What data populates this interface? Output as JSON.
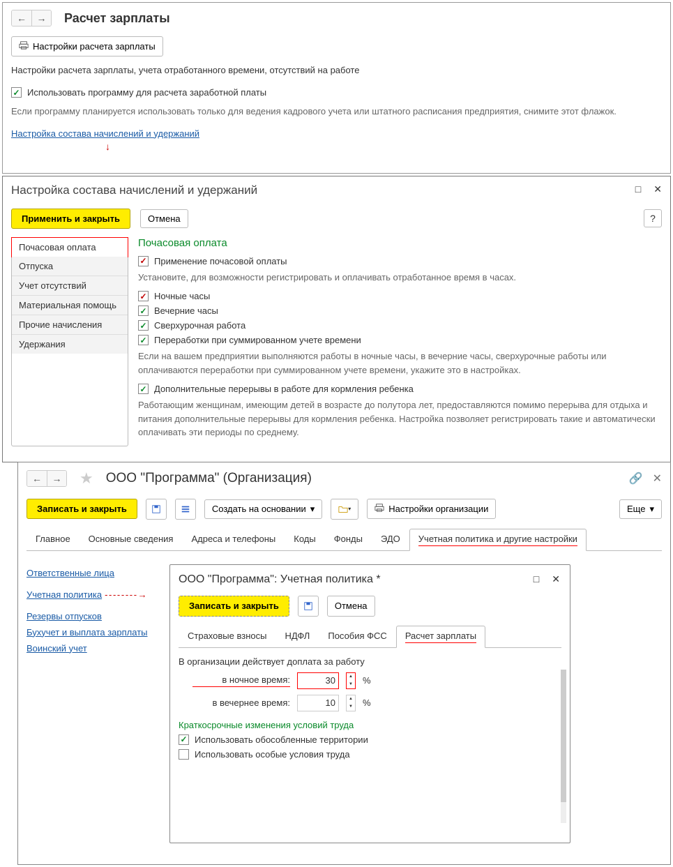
{
  "panel1": {
    "title": "Расчет зарплаты",
    "settings_btn": "Настройки расчета зарплаты",
    "description": "Настройки расчета зарплаты, учета отработанного времени, отсутствий на работе",
    "use_program_label": "Использовать программу для расчета заработной платы",
    "use_program_hint": "Если программу планируется использовать только для ведения кадрового учета или штатного расписания предприятия, снимите этот флажок.",
    "config_link": "Настройка состава начислений и удержаний"
  },
  "panel2": {
    "title": "Настройка состава начислений и удержаний",
    "apply_close": "Применить и закрыть",
    "cancel": "Отмена",
    "nav_items": [
      "Почасовая оплата",
      "Отпуска",
      "Учет отсутствий",
      "Материальная помощь",
      "Прочие начисления",
      "Удержания"
    ],
    "section_title": "Почасовая оплата",
    "hourly_pay": "Применение почасовой оплаты",
    "hourly_pay_hint": "Установите, для возможности регистрировать и оплачивать отработанное время в часах.",
    "night_hours": "Ночные часы",
    "evening_hours": "Вечерние часы",
    "overtime": "Сверхурочная работа",
    "summed_overtime": "Переработки при суммированном учете времени",
    "overtime_hint": "Если на вашем предприятии выполняются работы в ночные часы, в вечерние часы, сверхурочные работы или оплачиваются переработки при суммированном учете времени, укажите это в настройках.",
    "breaks": "Дополнительные перерывы в работе для кормления ребенка",
    "breaks_hint": "Работающим женщинам, имеющим детей в возрасте до полутора лет, предоставляются помимо перерыва для отдыха и питания дополнительные перерывы для кормления ребенка. Настройка позволяет регистрировать такие и автоматически оплачивать эти периоды по среднему."
  },
  "panel3": {
    "title": "ООО \"Программа\" (Организация)",
    "save_close": "Записать и закрыть",
    "create_based": "Создать на основании",
    "org_settings": "Настройки организации",
    "more": "Еще",
    "tabs": [
      "Главное",
      "Основные сведения",
      "Адреса и телефоны",
      "Коды",
      "Фонды",
      "ЭДО",
      "Учетная политика и другие настройки"
    ],
    "links": [
      "Ответственные лица",
      "Учетная политика",
      "Резервы отпусков",
      "Бухучет и выплата зарплаты",
      "Воинский учет"
    ]
  },
  "panel4": {
    "title": "ООО \"Программа\": Учетная политика *",
    "save_close": "Записать и закрыть",
    "cancel": "Отмена",
    "tabs": [
      "Страховые взносы",
      "НДФЛ",
      "Пособия ФСС",
      "Расчет зарплаты"
    ],
    "header_text": "В организации действует доплата за работу",
    "night_label": "в ночное время:",
    "night_value": "30",
    "evening_label": "в вечернее время:",
    "evening_value": "10",
    "percent": "%",
    "short_term": "Краткосрочные изменения условий труда",
    "use_territories": "Использовать обособленные территории",
    "use_conditions": "Использовать особые условия труда"
  }
}
